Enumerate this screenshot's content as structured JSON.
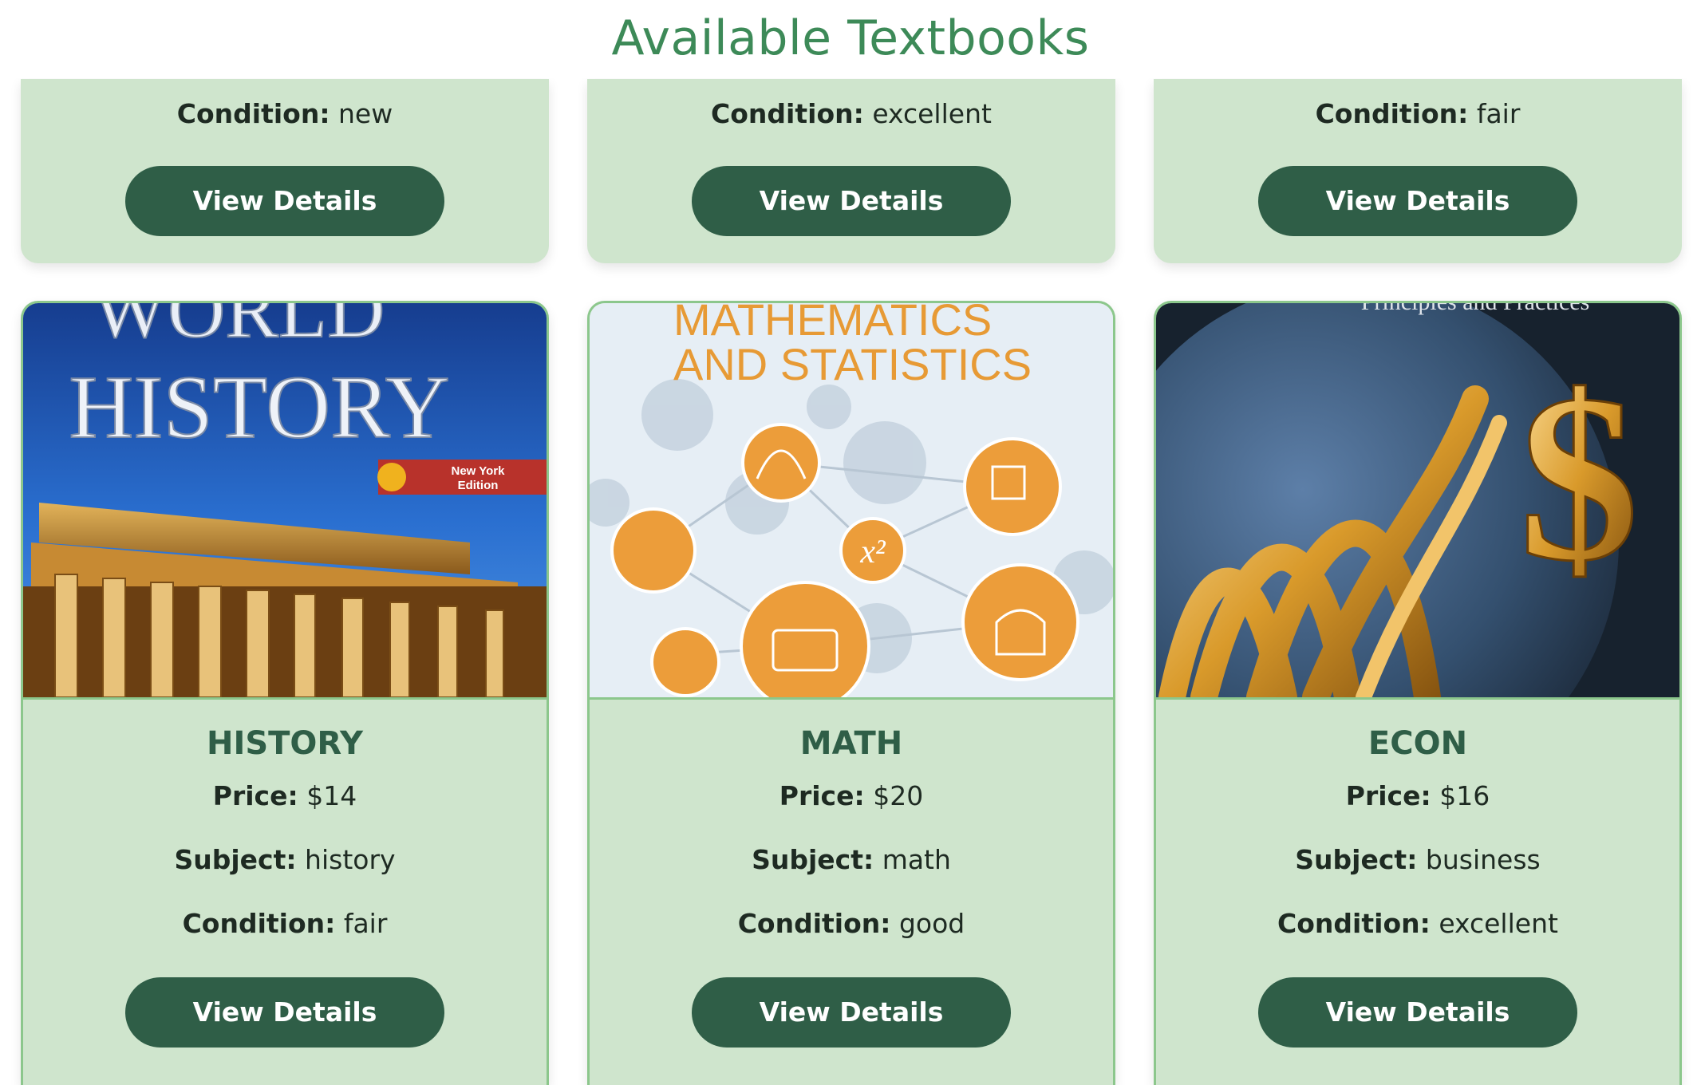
{
  "page": {
    "title": "Available Textbooks"
  },
  "labels": {
    "price": "Price:",
    "subject": "Subject:",
    "condition": "Condition:",
    "view_details": "View Details"
  },
  "top_row": [
    {
      "condition": "new"
    },
    {
      "condition": "excellent"
    },
    {
      "condition": "fair"
    }
  ],
  "books": [
    {
      "title": "HISTORY",
      "price": "$14",
      "subject": "history",
      "condition": "fair",
      "cover": {
        "heading_line1": "WORLD",
        "heading_line2": "HISTORY",
        "badge": "New York Edition",
        "badge_line1": "New York",
        "badge_line2": "Edition"
      }
    },
    {
      "title": "MATH",
      "price": "$20",
      "subject": "math",
      "condition": "good",
      "cover": {
        "heading_line1": "MATHEMATICS",
        "heading_line2": "AND STATISTICS",
        "formula": "x²"
      }
    },
    {
      "title": "ECON",
      "price": "$16",
      "subject": "business",
      "condition": "excellent",
      "cover": {
        "heading": "Principles and Practices",
        "symbol": "$"
      }
    }
  ],
  "colors": {
    "title": "#3d8a58",
    "card_bg": "#cfe5cd",
    "card_border": "#8cc78c",
    "button_bg": "#2f5e47",
    "button_text": "#ffffff",
    "book_title": "#2f5e47"
  }
}
